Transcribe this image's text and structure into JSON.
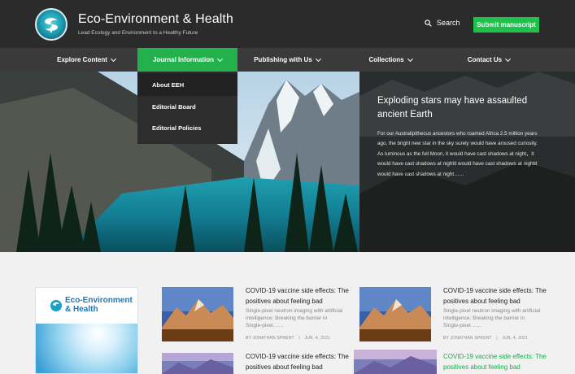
{
  "header": {
    "title": "Eco-Environment & Health",
    "tagline": "Lead Ecology and Environment to a Healthy Future",
    "search_label": "Search",
    "submit_label": "Submit manuscript"
  },
  "nav": {
    "items": [
      {
        "label": "Explore Content"
      },
      {
        "label": "Journal Information"
      },
      {
        "label": "Publishing with Us"
      },
      {
        "label": "Collections"
      },
      {
        "label": "Contact Us"
      }
    ],
    "active": "Journal Information",
    "dropdown": [
      "About EEH",
      "Editorial Board",
      "Editorial Policies"
    ]
  },
  "hero": {
    "title": "Exploding stars may have assaulted ancient Earth",
    "text": "For our Australipithecus ancestors who roamed Africa 2.5 million years ago, the bright new star in the sky surely would have aroused curiosity. As luminous as the full Moon, it would have cast shadows at night，it would have cast shadows at nightit would have cast shadows at nightit would have cast shadows at night……"
  },
  "cover": {
    "title_line1": "Eco-Environment",
    "title_line2": "& Health"
  },
  "articles": [
    {
      "title": "COVID-19 vaccine side effects: The positives about feeling bad",
      "desc": "Single-pixel neutron imaging with artificial intelligence: Breaking the barrier in Single-pixel……",
      "author": "BY JONATHAN SPRENT",
      "date": "JUN, 4, 2021"
    },
    {
      "title": "COVID-19 vaccine side effects: The positives about feeling bad",
      "desc": "Single-pixel neutron imaging with artificial intelligence: Breaking the barrier in Single-pixel……",
      "author": "BY JONATHAN SPRENT",
      "date": "JUN, 4, 2021"
    },
    {
      "title": "COVID-19 vaccine side effects: The positives about feeling bad"
    },
    {
      "title": "COVID-19 vaccine side effects: The positives about feeling bad"
    }
  ],
  "colors": {
    "accent": "#1fc14a",
    "header_bg": "#2b2b2b",
    "nav_bg": "#3a3a3a"
  }
}
